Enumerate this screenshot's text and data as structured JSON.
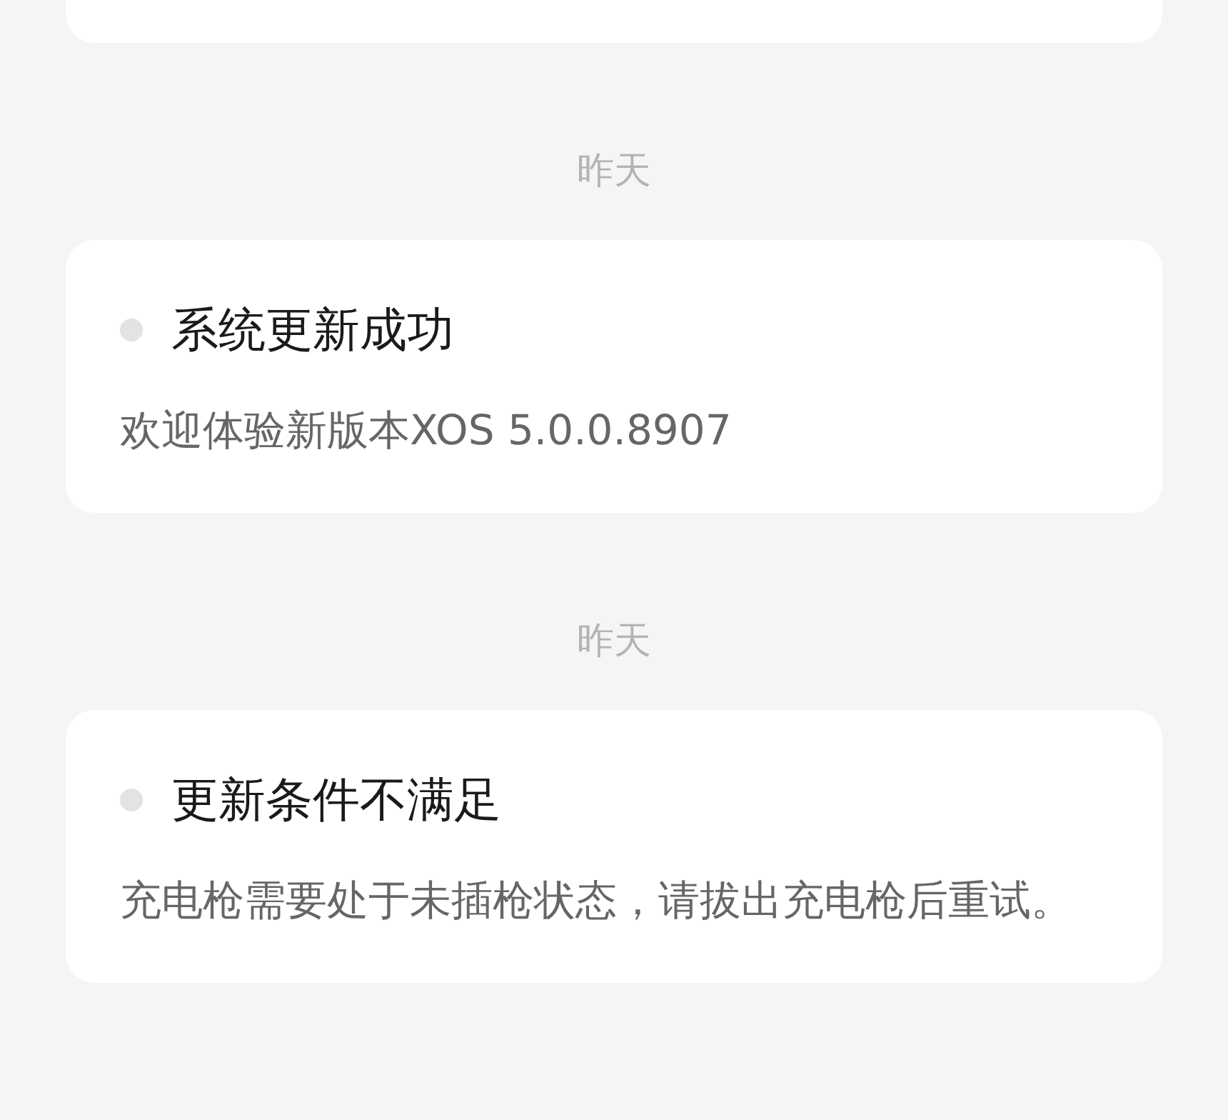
{
  "messages": [
    {
      "date": "昨天",
      "unread": false,
      "title": "系统更新成功",
      "body": "欢迎体验新版本XOS 5.0.0.8907"
    },
    {
      "date": "昨天",
      "unread": false,
      "title": "更新条件不满足",
      "body": "充电枪需要处于未插枪状态，请拔出充电枪后重试。"
    }
  ]
}
